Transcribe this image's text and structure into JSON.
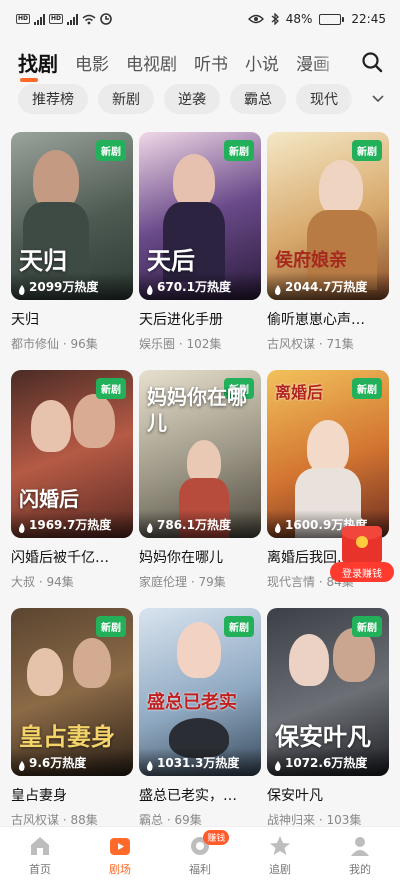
{
  "status_bar": {
    "battery": "48%",
    "time": "22:45",
    "battery_level": 0.48,
    "network_left": "HD",
    "network_right": "HD"
  },
  "tabs": [
    {
      "label": "找剧",
      "active": true
    },
    {
      "label": "电影"
    },
    {
      "label": "电视剧"
    },
    {
      "label": "听书"
    },
    {
      "label": "小说"
    },
    {
      "label": "漫画"
    }
  ],
  "search_icon": "search-icon",
  "chips": [
    "推荐榜",
    "新剧",
    "逆袭",
    "霸总",
    "现代"
  ],
  "badge_label": "新剧",
  "dramas": [
    {
      "poster_text": "天归",
      "heat": "2099万热度",
      "title": "天归",
      "meta": "都市修仙 · 96集"
    },
    {
      "poster_text": "天后",
      "heat": "670.1万热度",
      "title": "天后进化手册",
      "meta": "娱乐圈 · 102集"
    },
    {
      "poster_text": "侯府娘亲",
      "heat": "2044.7万热度",
      "title": "偷听崽崽心声…",
      "meta": "古风权谋 · 71集"
    },
    {
      "poster_text": "闪婚后",
      "heat": "1969.7万热度",
      "title": "闪婚后被千亿…",
      "meta": "大叔 · 94集"
    },
    {
      "poster_text": "妈妈你在哪儿",
      "heat": "786.1万热度",
      "title": "妈妈你在哪儿",
      "meta": "家庭伦理 · 79集"
    },
    {
      "poster_text": "离婚后",
      "heat": "1600.9万热度",
      "title": "离婚后我回…",
      "meta": "现代言情 · 84集"
    },
    {
      "poster_text": "皇占妻身",
      "heat": "9.6万热度",
      "title": "皇占妻身",
      "meta": "古风权谋 · 88集"
    },
    {
      "poster_text": "盛总已老实",
      "heat": "1031.3万热度",
      "title": "盛总已老实，…",
      "meta": "霸总 · 69集"
    },
    {
      "poster_text": "保安叶凡",
      "heat": "1072.6万热度",
      "title": "保安叶凡",
      "meta": "战神归来 · 103集"
    }
  ],
  "red_packet": {
    "label": "登录赚钱"
  },
  "bottom_nav": [
    {
      "label": "首页",
      "icon": "home-icon"
    },
    {
      "label": "剧场",
      "icon": "theater-icon",
      "active": true
    },
    {
      "label": "福利",
      "icon": "gift-icon",
      "badge": "赚钱"
    },
    {
      "label": "追剧",
      "icon": "star-icon"
    },
    {
      "label": "我的",
      "icon": "profile-icon"
    }
  ],
  "colors": {
    "accent": "#ff6a2a",
    "badge_green": "#22b15a",
    "red_packet": "#e8332b"
  }
}
